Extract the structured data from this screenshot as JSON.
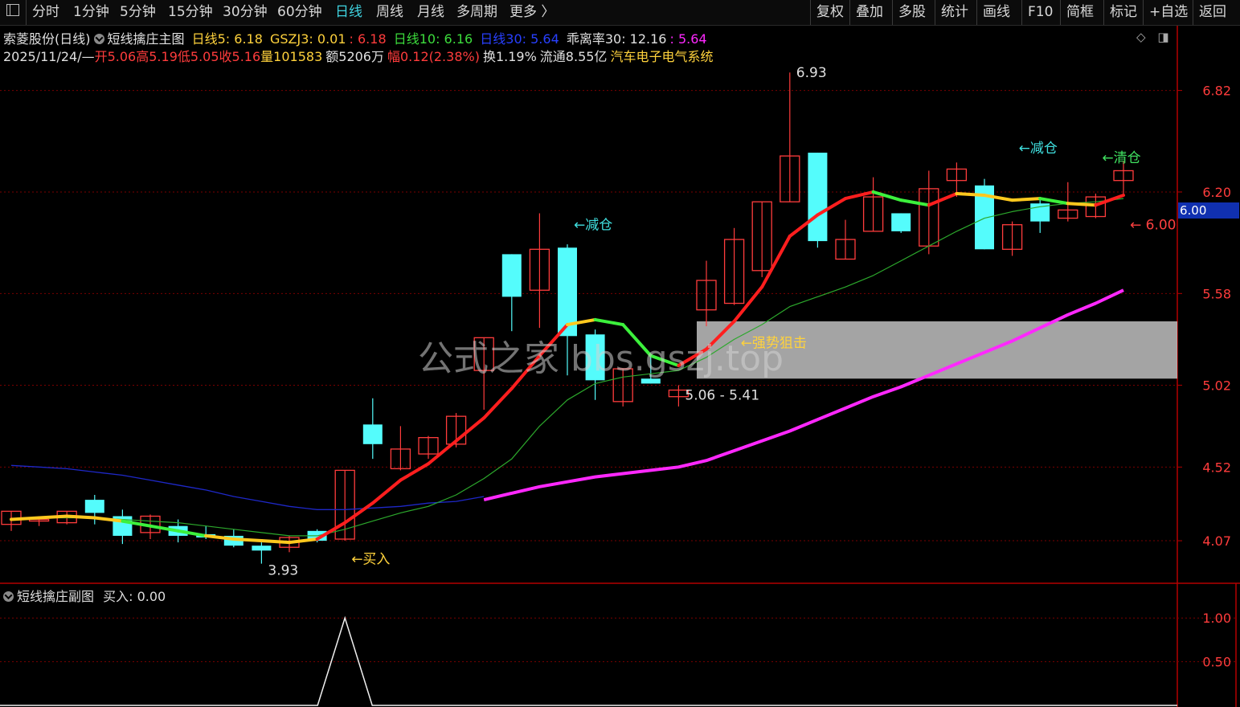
{
  "toolbar": {
    "left_buttons": [
      {
        "label": "分时"
      },
      {
        "label": "1分钟"
      },
      {
        "label": "5分钟"
      },
      {
        "label": "15分钟"
      },
      {
        "label": "30分钟"
      },
      {
        "label": "60分钟"
      },
      {
        "label": "日线",
        "active": true
      },
      {
        "label": "周线"
      },
      {
        "label": "月线"
      },
      {
        "label": "多周期"
      },
      {
        "label": "更多 〉"
      }
    ],
    "right_buttons": [
      {
        "label": "复权"
      },
      {
        "label": "叠加"
      },
      {
        "label": "多股"
      },
      {
        "label": "统计"
      },
      {
        "label": "画线"
      },
      {
        "label": "F10"
      },
      {
        "label": "简框"
      },
      {
        "label": "标记"
      },
      {
        "label": "+自选"
      },
      {
        "label": "返回"
      }
    ]
  },
  "header": {
    "stock": "索菱股份(日线)",
    "indicator": "短线擒庄主图",
    "ma5": "日线5: 6.18",
    "gszj3": "GSZJ3: 0.01",
    "gszj3_b": ": 6.18",
    "ma10": "日线10: 6.16",
    "ma30": "日线30: 5.64",
    "bias": "乖离率30: 12.16",
    "bias_b": ": 5.64"
  },
  "ohlc": {
    "date": "2025/11/24/—",
    "open": "开5.06",
    "high": "高5.19",
    "low": "低5.05",
    "close": "收5.16",
    "volume": "量101583",
    "amount": "额5206万",
    "change": "幅0.12(2.38%)",
    "turnover": "换1.19%",
    "float": "流通8.55亿",
    "sector": "汽车电子电气系统"
  },
  "price_tag": "6.00",
  "watermark": "公式之家 bbs.gszj.top",
  "sub_header": {
    "indicator": "短线擒庄副图",
    "value": "买入: 0.00"
  },
  "colors": {
    "up": "#ff3c3c",
    "down": "#54fcfc",
    "ma_long": "#ff28ff",
    "zone": "#c8c8c8",
    "axis": "#b40000"
  },
  "chart_data": {
    "type": "candlestick",
    "ylim": [
      3.82,
      6.98
    ],
    "y_ticks": [
      4.07,
      4.52,
      5.02,
      5.58,
      6.2,
      6.82
    ],
    "candles": [
      {
        "o": 4.17,
        "h": 4.24,
        "l": 4.13,
        "c": 4.25
      },
      {
        "o": 4.2,
        "h": 4.21,
        "l": 4.16,
        "c": 4.2
      },
      {
        "o": 4.18,
        "h": 4.22,
        "l": 4.17,
        "c": 4.25
      },
      {
        "o": 4.32,
        "h": 4.35,
        "l": 4.17,
        "c": 4.24
      },
      {
        "o": 4.22,
        "h": 4.26,
        "l": 4.05,
        "c": 4.1
      },
      {
        "o": 4.12,
        "h": 4.23,
        "l": 4.08,
        "c": 4.22
      },
      {
        "o": 4.16,
        "h": 4.2,
        "l": 4.06,
        "c": 4.1
      },
      {
        "o": 4.11,
        "h": 4.16,
        "l": 4.08,
        "c": 4.09
      },
      {
        "o": 4.1,
        "h": 4.14,
        "l": 4.03,
        "c": 4.04
      },
      {
        "o": 4.04,
        "h": 4.06,
        "l": 3.93,
        "c": 4.01
      },
      {
        "o": 4.03,
        "h": 4.1,
        "l": 4.0,
        "c": 4.09
      },
      {
        "o": 4.13,
        "h": 4.14,
        "l": 4.06,
        "c": 4.07
      },
      {
        "o": 4.08,
        "h": 4.5,
        "l": 4.07,
        "c": 4.5
      },
      {
        "o": 4.78,
        "h": 4.94,
        "l": 4.57,
        "c": 4.66
      },
      {
        "o": 4.51,
        "h": 4.77,
        "l": 4.5,
        "c": 4.63
      },
      {
        "o": 4.6,
        "h": 4.71,
        "l": 4.57,
        "c": 4.7
      },
      {
        "o": 4.66,
        "h": 4.85,
        "l": 4.64,
        "c": 4.83
      },
      {
        "o": 5.11,
        "h": 5.12,
        "l": 4.87,
        "c": 5.31
      },
      {
        "o": 5.82,
        "h": 5.77,
        "l": 5.35,
        "c": 5.56
      },
      {
        "o": 5.6,
        "h": 6.07,
        "l": 5.37,
        "c": 5.85
      },
      {
        "o": 5.86,
        "h": 5.88,
        "l": 5.08,
        "c": 5.32
      },
      {
        "o": 5.33,
        "h": 5.36,
        "l": 4.93,
        "c": 5.05
      },
      {
        "o": 4.92,
        "h": 5.09,
        "l": 4.89,
        "c": 5.12
      },
      {
        "o": 5.06,
        "h": 5.19,
        "l": 5.03,
        "c": 5.03
      },
      {
        "o": 4.95,
        "h": 5.02,
        "l": 4.89,
        "c": 4.99
      },
      {
        "o": 5.48,
        "h": 5.78,
        "l": 5.38,
        "c": 5.66
      },
      {
        "o": 5.52,
        "h": 5.98,
        "l": 5.51,
        "c": 5.91
      },
      {
        "o": 5.72,
        "h": 6.1,
        "l": 5.68,
        "c": 6.14
      },
      {
        "o": 6.14,
        "h": 6.93,
        "l": 6.14,
        "c": 6.42
      },
      {
        "o": 6.44,
        "h": 6.34,
        "l": 5.86,
        "c": 5.9
      },
      {
        "o": 5.79,
        "h": 6.03,
        "l": 5.79,
        "c": 5.91
      },
      {
        "o": 5.96,
        "h": 6.29,
        "l": 5.96,
        "c": 6.17
      },
      {
        "o": 6.07,
        "h": 6.07,
        "l": 5.95,
        "c": 5.96
      },
      {
        "o": 5.87,
        "h": 6.33,
        "l": 5.82,
        "c": 6.22
      },
      {
        "o": 6.27,
        "h": 6.38,
        "l": 6.17,
        "c": 6.34
      },
      {
        "o": 6.24,
        "h": 6.28,
        "l": 5.85,
        "c": 5.85
      },
      {
        "o": 5.85,
        "h": 6.02,
        "l": 5.81,
        "c": 6.0
      },
      {
        "o": 6.13,
        "h": 6.17,
        "l": 5.95,
        "c": 6.02
      },
      {
        "o": 6.04,
        "h": 6.26,
        "l": 6.02,
        "c": 6.09
      },
      {
        "o": 6.05,
        "h": 6.19,
        "l": 6.04,
        "c": 6.17
      },
      {
        "o": 6.27,
        "h": 6.39,
        "l": 6.19,
        "c": 6.33
      }
    ],
    "ma_fast": [
      4.2,
      4.21,
      4.22,
      4.21,
      4.19,
      4.16,
      4.13,
      4.1,
      4.08,
      4.07,
      4.06,
      4.08,
      4.18,
      4.3,
      4.44,
      4.54,
      4.68,
      4.82,
      5.0,
      5.2,
      5.39,
      5.42,
      5.39,
      5.2,
      5.14,
      5.24,
      5.41,
      5.62,
      5.93,
      6.06,
      6.16,
      6.2,
      6.15,
      6.12,
      6.19,
      6.18,
      6.15,
      6.16,
      6.13,
      6.12,
      6.18
    ],
    "ma_mid": [
      4.2,
      4.21,
      4.21,
      4.21,
      4.2,
      4.19,
      4.18,
      4.16,
      4.14,
      4.12,
      4.1,
      4.1,
      4.14,
      4.19,
      4.24,
      4.28,
      4.35,
      4.45,
      4.57,
      4.77,
      4.93,
      5.03,
      5.07,
      5.09,
      5.11,
      5.19,
      5.3,
      5.39,
      5.5,
      5.56,
      5.62,
      5.69,
      5.78,
      5.87,
      5.96,
      6.04,
      6.08,
      6.11,
      6.13,
      6.14,
      6.16
    ],
    "ma_long_from": 17,
    "ma_long": [
      4.32,
      4.36,
      4.4,
      4.43,
      4.46,
      4.48,
      4.5,
      4.52,
      4.56,
      4.62,
      4.68,
      4.74,
      4.81,
      4.88,
      4.95,
      5.01,
      5.08,
      5.15,
      5.22,
      5.29,
      5.37,
      5.45,
      5.52,
      5.6
    ],
    "ma_base": [
      4.53,
      4.52,
      4.51,
      4.49,
      4.47,
      4.44,
      4.41,
      4.38,
      4.34,
      4.31,
      4.28,
      4.26,
      4.26,
      4.27,
      4.28,
      4.3,
      4.31,
      4.34
    ],
    "zone": {
      "from": 25,
      "low": 5.06,
      "high": 5.41
    },
    "annotations": [
      {
        "text": "←减仓",
        "i": 20,
        "y": 6.0,
        "color": "#40e0e0"
      },
      {
        "text": "←减仓",
        "i": 36,
        "y": 6.47,
        "color": "#40e0e0"
      },
      {
        "text": "←清仓",
        "i": 39,
        "y": 6.41,
        "color": "#40e060"
      },
      {
        "text": "←强势狙击",
        "i": 26,
        "y": 5.28,
        "color": "#ffd23c"
      },
      {
        "text": "←买入",
        "i": 12,
        "y": 3.96,
        "color": "#ffd23c"
      },
      {
        "text": "5.06 - 5.41",
        "i": 24,
        "y": 4.96,
        "color": "#e0e0e0"
      },
      {
        "text": "6.93",
        "i": 28,
        "y": 6.93,
        "color": "#e0e0e0"
      },
      {
        "text": "3.93",
        "i": 9,
        "y": 3.89,
        "color": "#e0e0e0"
      },
      {
        "text": "← 6.00",
        "i": 40,
        "y": 6.0,
        "color": "#ff4040"
      }
    ],
    "sub": {
      "ylim": [
        0,
        1.25
      ],
      "y_ticks": [
        0.5,
        1.0
      ],
      "spike_index": 12,
      "value": 1.0
    }
  }
}
